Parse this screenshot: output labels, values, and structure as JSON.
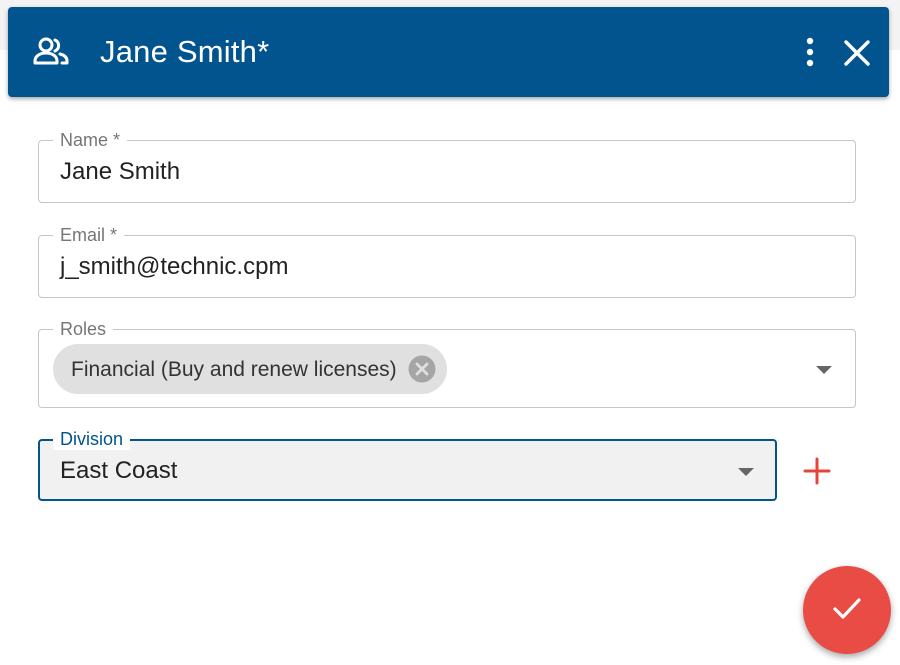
{
  "dialog": {
    "title": "Jane Smith*",
    "header_icon": "users-icon",
    "actions": {
      "menu_icon": "more-vertical-icon",
      "close_icon": "close-icon"
    }
  },
  "form": {
    "name": {
      "label": "Name *",
      "value": "Jane Smith"
    },
    "email": {
      "label": "Email *",
      "value": "j_smith@technic.cpm"
    },
    "roles": {
      "label": "Roles",
      "chips": [
        {
          "label": "Financial (Buy and renew licenses)",
          "remove_icon": "close-circle-icon"
        }
      ],
      "dropdown_icon": "chevron-down-icon"
    },
    "division": {
      "label": "Division",
      "value": "East Coast",
      "dropdown_icon": "chevron-down-icon",
      "add_icon": "plus-icon"
    }
  },
  "fab": {
    "icon": "check-icon"
  },
  "colors": {
    "header_bg": "#02548f",
    "header_text": "#ffffff",
    "accent": "#02548f",
    "fab_bg": "#e84c44",
    "add_icon": "#e8433a",
    "chip_bg": "#e0e0e0",
    "field_border": "#c6c6c6",
    "division_bg": "#f1f1f1"
  }
}
